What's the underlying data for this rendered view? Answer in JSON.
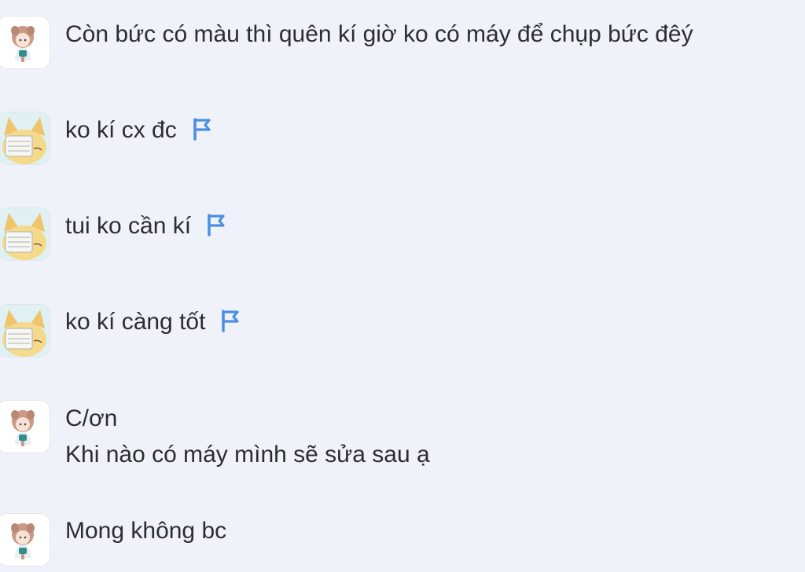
{
  "comments": [
    {
      "avatar_icon": "girl-avatar-icon",
      "lines": [
        "Còn bức có màu thì quên kí giờ ko có máy để chụp bức đêý"
      ],
      "has_report_flag": false
    },
    {
      "avatar_icon": "fox-mask-avatar-icon",
      "lines": [
        "ko kí cx đc"
      ],
      "has_report_flag": true
    },
    {
      "avatar_icon": "fox-mask-avatar-icon",
      "lines": [
        "tui ko cần kí"
      ],
      "has_report_flag": true
    },
    {
      "avatar_icon": "fox-mask-avatar-icon",
      "lines": [
        "ko kí càng tốt"
      ],
      "has_report_flag": true
    },
    {
      "avatar_icon": "girl-avatar-icon",
      "lines": [
        "C/ơn",
        "Khi nào có máy mình sẽ sửa sau ạ"
      ],
      "has_report_flag": false
    },
    {
      "avatar_icon": "girl-avatar-icon",
      "lines": [
        "Mong không bc"
      ],
      "has_report_flag": false
    }
  ],
  "colors": {
    "background": "#eff2f8",
    "text": "#2b2d31",
    "flag": "#4a90e2"
  }
}
